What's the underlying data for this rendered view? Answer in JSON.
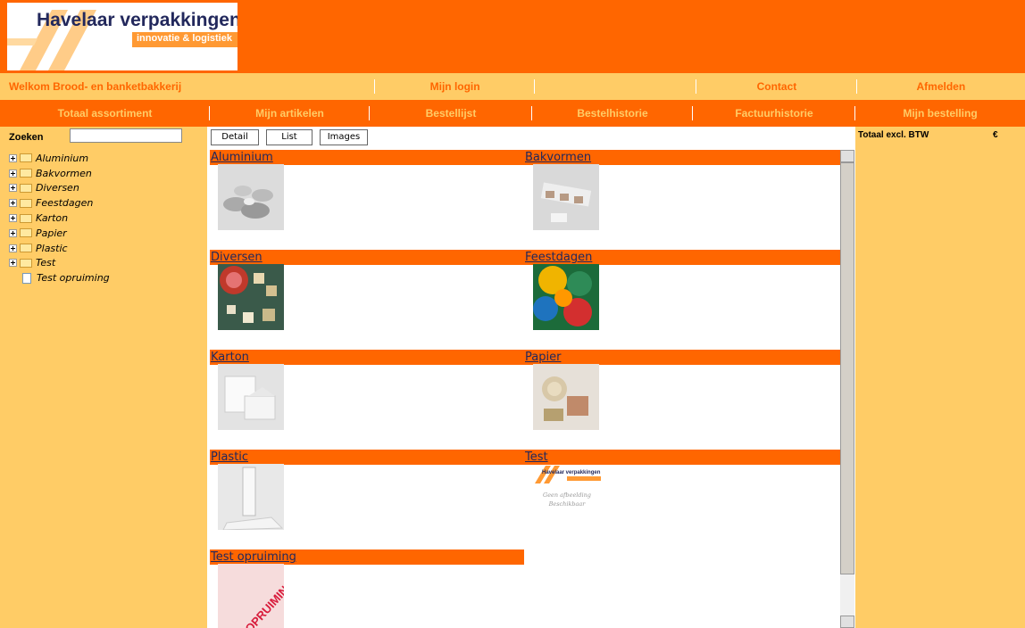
{
  "logo": {
    "title": "Havelaar verpakkingen",
    "tagline": "innovatie & logistiek"
  },
  "nav_top": {
    "welcome": "Welkom Brood- en banketbakkerij",
    "login": "Mijn login",
    "blank": "",
    "contact": "Contact",
    "logout": "Afmelden"
  },
  "nav_main": [
    "Totaal assortiment",
    "Mijn artikelen",
    "Bestellijst",
    "Bestelhistorie",
    "Factuurhistorie",
    "Mijn bestelling"
  ],
  "search": {
    "label": "Zoeken",
    "value": ""
  },
  "tree": [
    {
      "label": "Aluminium"
    },
    {
      "label": "Bakvormen"
    },
    {
      "label": "Diversen"
    },
    {
      "label": "Feestdagen"
    },
    {
      "label": "Karton"
    },
    {
      "label": "Papier"
    },
    {
      "label": "Plastic"
    },
    {
      "label": "Test"
    },
    {
      "label": "Test opruiming"
    }
  ],
  "view_buttons": [
    "Detail",
    "List",
    "Images"
  ],
  "categories": [
    {
      "title": "Aluminium",
      "image": "aluminium-image"
    },
    {
      "title": "Bakvormen",
      "image": "bakvormen-image"
    },
    {
      "title": "Diversen",
      "image": "diversen-image"
    },
    {
      "title": "Feestdagen",
      "image": "feestdagen-image"
    },
    {
      "title": "Karton",
      "image": "karton-image"
    },
    {
      "title": "Papier",
      "image": "papier-image"
    },
    {
      "title": "Plastic",
      "image": "plastic-image"
    },
    {
      "title": "Test",
      "image": "test-image",
      "image_text": [
        "Havelaar verpakkingen",
        "Geen afbeelding",
        "Beschikbaar"
      ]
    },
    {
      "title": "Test opruiming",
      "image": "opruiming-image",
      "image_text": [
        "OPRUIMING"
      ]
    }
  ],
  "cart": {
    "total_label": "Totaal excl. BTW",
    "currency": "€"
  },
  "colors": {
    "orange": "#ff6600",
    "light_orange": "#ffcc66",
    "navy": "#22285c"
  }
}
